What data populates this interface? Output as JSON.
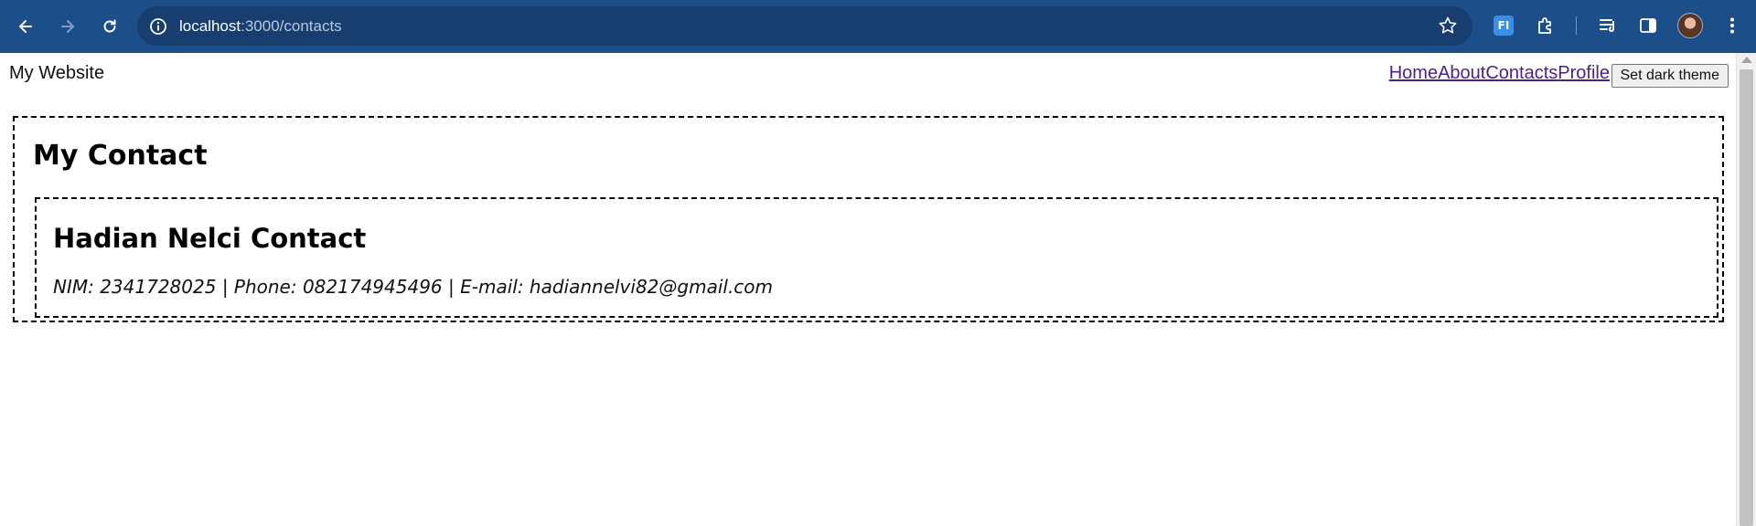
{
  "browser": {
    "url_host": "localhost",
    "url_path": ":3000/contacts",
    "extension_label": "FI",
    "icons": [
      "back-arrow-icon",
      "forward-arrow-icon",
      "reload-icon",
      "site-info-icon",
      "bookmark-star-icon",
      "extensions-puzzle-icon",
      "reading-list-icon",
      "side-panel-icon",
      "menu-dots-icon"
    ]
  },
  "site": {
    "brand": "My Website",
    "nav": [
      "Home",
      "About",
      "Contacts",
      "Profile"
    ],
    "theme_button": "Set dark theme"
  },
  "contact_section": {
    "title": "My Contact",
    "card": {
      "title": "Hadian Nelci Contact",
      "info": "NIM: 2341728025 | Phone: 082174945496 | E-mail: hadiannelvi82@gmail.com"
    }
  },
  "colors": {
    "chrome_bg": "#1c4f8a",
    "omnibox_bg": "#173e6f",
    "link_visited": "#4b1f8c"
  }
}
